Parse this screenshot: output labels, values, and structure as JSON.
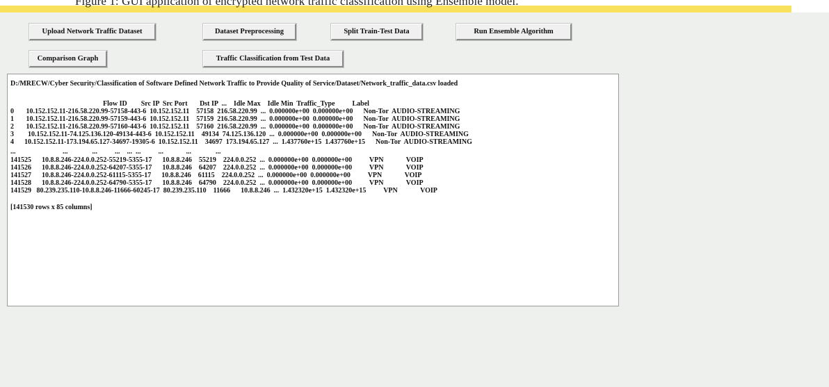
{
  "caption": "Figure 1: GUI application of encrypted network traffic classification using Ensemble model.",
  "buttons": {
    "upload": "Upload Network Traffic Dataset",
    "preprocess": "Dataset Preprocessing",
    "split": "Split Train-Test Data",
    "ensemble": "Run Ensemble Algorithm",
    "graph": "Comparison Graph",
    "classify": "Traffic Classification from Test Data"
  },
  "output": {
    "loaded_message": "D:/MRECW/Cyber Security/Classification of Software Defined Network Traffic to Provide Quality of Service/Dataset/Network_traffic_data.csv loaded",
    "header": "Flow ID        Src IP  Src Port       Dst IP  ...    Idle Max    Idle Min  Traffic_Type          Label",
    "rows_top": [
      "0       10.152.152.11-216.58.220.99-57158-443-6  10.152.152.11    57158  216.58.220.99  ...  0.000000e+00  0.000000e+00      Non-Tor  AUDIO-STREAMING",
      "1       10.152.152.11-216.58.220.99-57159-443-6  10.152.152.11    57159  216.58.220.99  ...  0.000000e+00  0.000000e+00      Non-Tor  AUDIO-STREAMING",
      "2       10.152.152.11-216.58.220.99-57160-443-6  10.152.152.11    57160  216.58.220.99  ...  0.000000e+00  0.000000e+00      Non-Tor  AUDIO-STREAMING",
      "3        10.152.152.11-74.125.136.120-49134-443-6  10.152.152.11    49134  74.125.136.120  ...  0.000000e+00  0.000000e+00      Non-Tor  AUDIO-STREAMING",
      "4      10.152.152.11-173.194.65.127-34697-19305-6  10.152.152.11    34697  173.194.65.127  ...  1.437760e+15  1.437760e+15      Non-Tor  AUDIO-STREAMING"
    ],
    "ellipsis_row": "...                           ...              ...          ...    ...  ...          ...             ...              ...",
    "rows_bottom": [
      "141525      10.8.8.246-224.0.0.252-55219-5355-17      10.8.8.246    55219    224.0.0.252  ...  0.000000e+00  0.000000e+00          VPN             VOIP",
      "141526      10.8.8.246-224.0.0.252-64207-5355-17      10.8.8.246    64207    224.0.0.252  ...  0.000000e+00  0.000000e+00          VPN             VOIP",
      "141527      10.8.8.246-224.0.0.252-61115-5355-17      10.8.8.246    61115    224.0.0.252  ...  0.000000e+00  0.000000e+00          VPN             VOIP",
      "141528      10.8.8.246-224.0.0.252-64790-5355-17      10.8.8.246    64790    224.0.0.252  ...  0.000000e+00  0.000000e+00          VPN             VOIP",
      "141529   80.239.235.110-10.8.8.246-11666-60245-17  80.239.235.110    11666      10.8.8.246  ...  1.432320e+15  1.432320e+15          VPN             VOIP"
    ],
    "summary": "[141530 rows x 85 columns]"
  }
}
